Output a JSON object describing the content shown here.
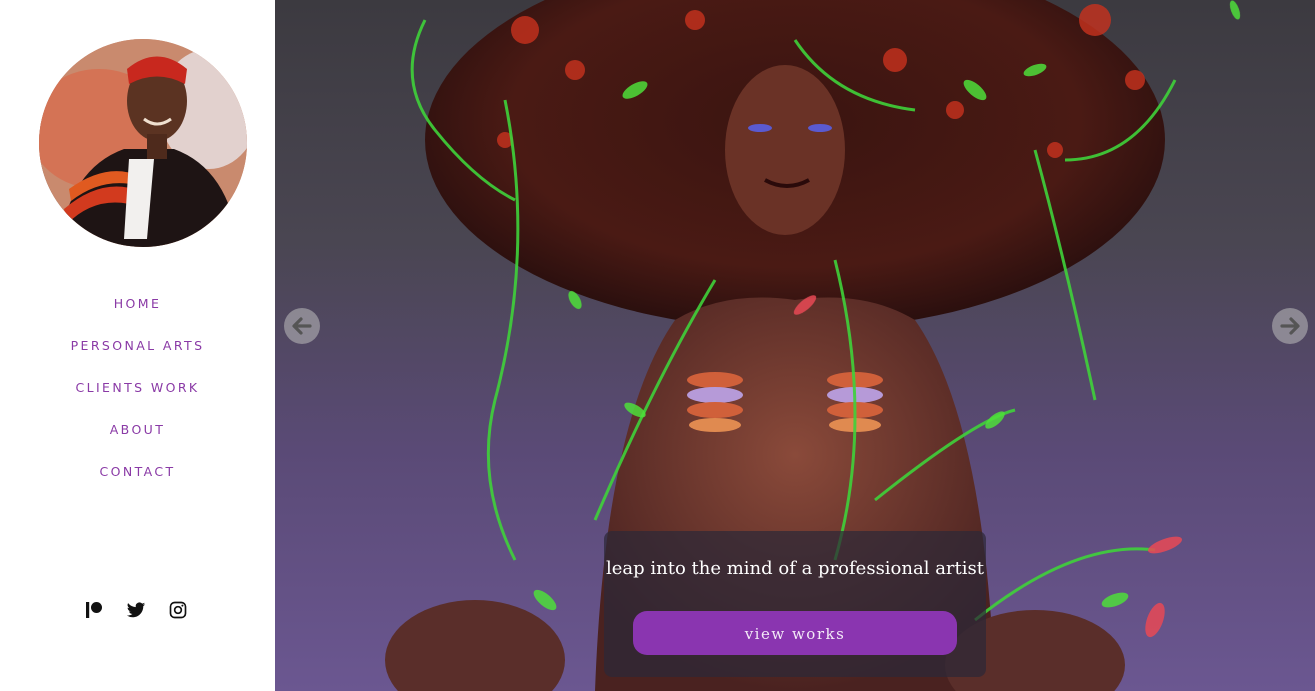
{
  "nav": {
    "items": [
      {
        "label": "HOME"
      },
      {
        "label": "PERSONAL ARTS"
      },
      {
        "label": "CLIENTS WORK"
      },
      {
        "label": "ABOUT"
      },
      {
        "label": "CONTACT"
      }
    ]
  },
  "social": {
    "icons": [
      "patreon-icon",
      "twitter-icon",
      "instagram-icon"
    ]
  },
  "hero": {
    "tagline": "leap into the mind of a professional artist",
    "cta_label": "view works"
  },
  "colors": {
    "accent": "#8a35b0",
    "nav_text": "#8a3aa6",
    "cta_overlay": "#2d2837"
  }
}
